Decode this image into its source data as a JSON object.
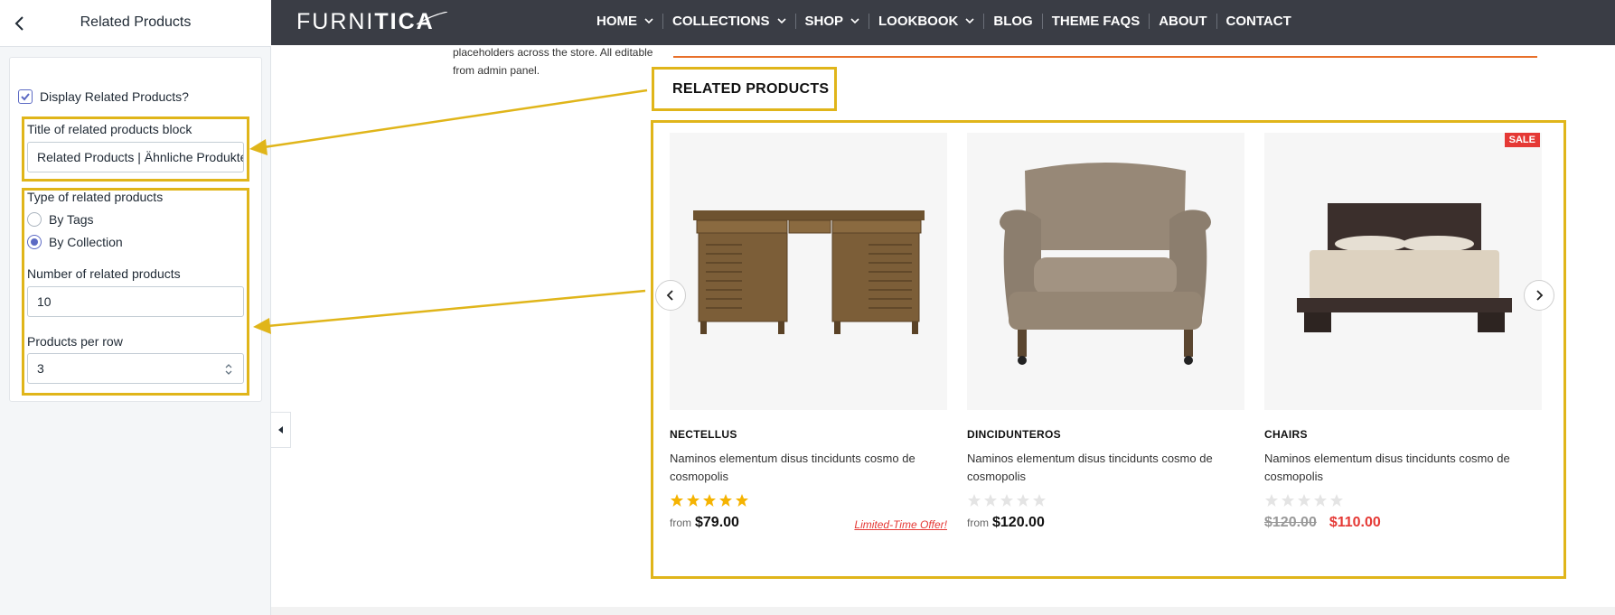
{
  "editor": {
    "title": "Related Products",
    "display_label": "Display Related Products?",
    "display_checked": true,
    "title_field_label": "Title of related products block",
    "title_field_value": "Related Products | Ähnliche Produkte",
    "type_label": "Type of related products",
    "type_options": [
      "By Tags",
      "By Collection"
    ],
    "type_selected": "By Collection",
    "count_label": "Number of related products",
    "count_value": "10",
    "per_row_label": "Products per row",
    "per_row_value": "3"
  },
  "store": {
    "logo_thin": "FURNI",
    "logo_bold": "TICA",
    "nav": [
      {
        "label": "HOME",
        "dropdown": true
      },
      {
        "label": "COLLECTIONS",
        "dropdown": true
      },
      {
        "label": "SHOP",
        "dropdown": true
      },
      {
        "label": "LOOKBOOK",
        "dropdown": true
      },
      {
        "label": "BLOG",
        "dropdown": false
      },
      {
        "label": "THEME FAQS",
        "dropdown": false
      },
      {
        "label": "ABOUT",
        "dropdown": false
      },
      {
        "label": "CONTACT",
        "dropdown": false
      }
    ],
    "placeholder_text": "placeholders across the store. All editable from admin panel.",
    "related_title": "RELATED PRODUCTS",
    "products": [
      {
        "name": "NECTELLUS",
        "description": "Naminos elementum disus tincidunts cosmo de cosmopolis",
        "rating": 5,
        "price_prefix": "from",
        "price": "$79.00",
        "offer": "Limited-Time Offer!",
        "image": "desk-icon"
      },
      {
        "name": "DINCIDUNTEROS",
        "description": "Naminos elementum disus tincidunts cosmo de cosmopolis",
        "rating": 0,
        "price_prefix": "from",
        "price": "$120.00",
        "image": "armchair-icon"
      },
      {
        "name": "CHAIRS",
        "description": "Naminos elementum disus tincidunts cosmo de cosmopolis",
        "rating": 0,
        "old_price": "$120.00",
        "sale_price": "$110.00",
        "badge": "SALE",
        "image": "bed-icon"
      }
    ]
  },
  "colors": {
    "highlight": "#e0b51a",
    "nav_bg": "#3a3d45",
    "accent_line": "#e8702a",
    "sale_red": "#e53935",
    "star_gold": "#f5b301",
    "checkbox_blue": "#5c6ac4"
  }
}
